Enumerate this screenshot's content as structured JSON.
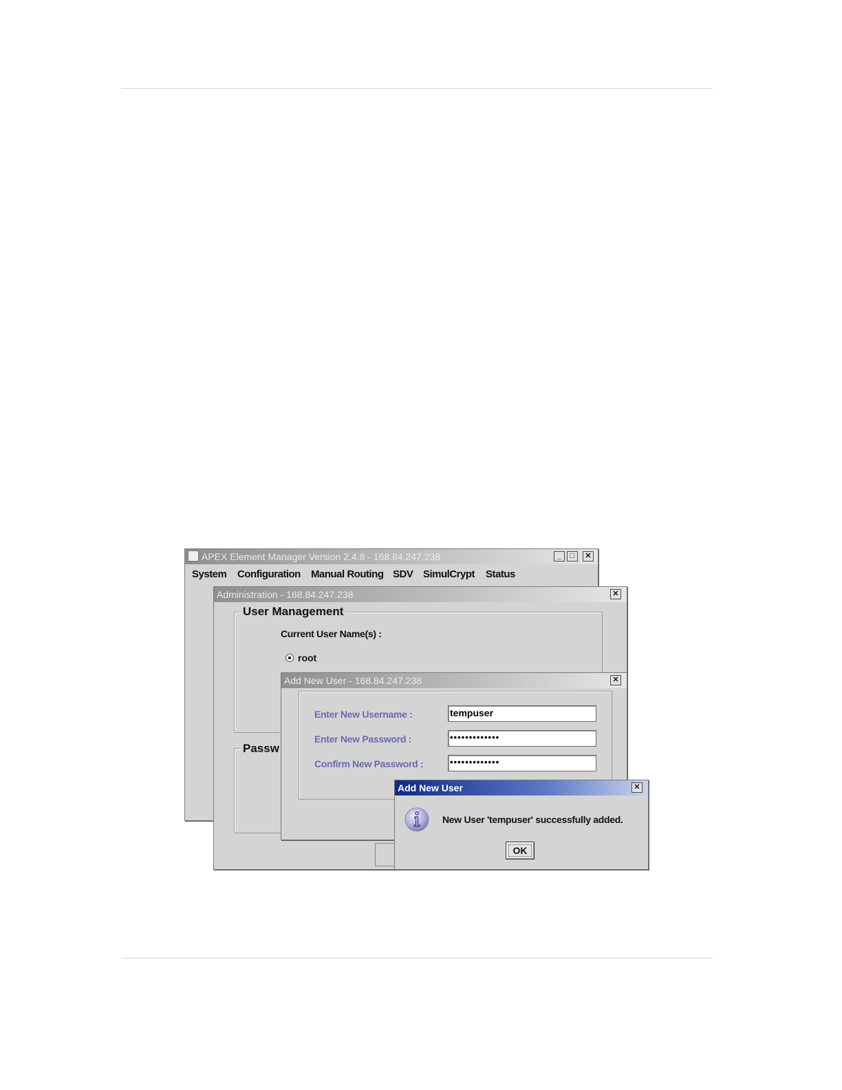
{
  "main_window": {
    "title": "APEX Element Manager Version 2.4.8 - 168.84.247.238",
    "menu": [
      "System",
      "Configuration",
      "Manual Routing",
      "SDV",
      "SimulCrypt",
      "Status"
    ]
  },
  "admin_window": {
    "title": "Administration - 168.84.247.238",
    "group_user_mgmt": "User Management",
    "current_users_label": "Current User Name(s) :",
    "users": [
      {
        "name": "root",
        "selected": true
      }
    ],
    "group_password": "Passw"
  },
  "add_user_window": {
    "title": "Add New User - 168.84.247.238",
    "username_label": "Enter New Username :",
    "username_value": "tempuser",
    "password_label": "Enter New Password :",
    "password_value": "•••••••••••••",
    "confirm_label": "Confirm New Password :",
    "confirm_value": "•••••••••••••"
  },
  "message_dialog": {
    "title": "Add New User",
    "icon": "info-icon",
    "message": "New User 'tempuser' successfully added.",
    "ok_label": "OK"
  },
  "window_controls": {
    "minimize": "_",
    "maximize": "□",
    "close": "✕"
  }
}
